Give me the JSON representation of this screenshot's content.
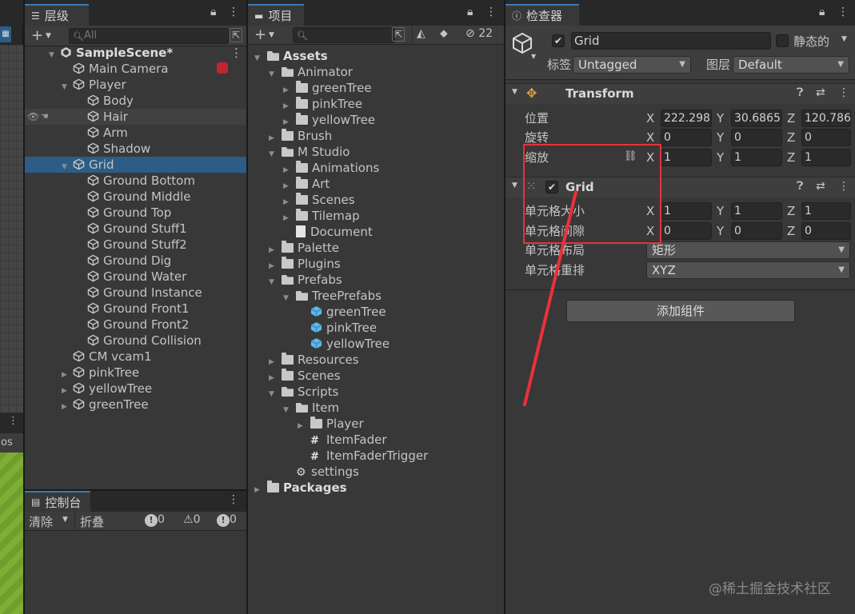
{
  "hierarchy": {
    "tab_label": "层级",
    "search_placeholder": "All",
    "rows": [
      {
        "label": "SampleScene*",
        "level": 0,
        "scene": true
      },
      {
        "label": "Main Camera",
        "level": 1
      },
      {
        "label": "Player",
        "level": 1,
        "fold": "open"
      },
      {
        "label": "Body",
        "level": 2
      },
      {
        "label": "Hair",
        "level": 2,
        "hover": true
      },
      {
        "label": "Arm",
        "level": 2
      },
      {
        "label": "Shadow",
        "level": 2
      },
      {
        "label": "Grid",
        "level": 1,
        "fold": "open",
        "selected": true
      },
      {
        "label": "Ground Bottom",
        "level": 2
      },
      {
        "label": "Ground Middle",
        "level": 2
      },
      {
        "label": "Ground Top",
        "level": 2
      },
      {
        "label": "Ground Stuff1",
        "level": 2
      },
      {
        "label": "Ground Stuff2",
        "level": 2
      },
      {
        "label": "Ground Dig",
        "level": 2
      },
      {
        "label": "Ground Water",
        "level": 2
      },
      {
        "label": "Ground Instance",
        "level": 2
      },
      {
        "label": "Ground Front1",
        "level": 2
      },
      {
        "label": "Ground Front2",
        "level": 2
      },
      {
        "label": "Ground Collision",
        "level": 2
      },
      {
        "label": "CM vcam1",
        "level": 1
      },
      {
        "label": "pinkTree",
        "level": 1,
        "fold": "closed"
      },
      {
        "label": "yellowTree",
        "level": 1,
        "fold": "closed"
      },
      {
        "label": "greenTree",
        "level": 1,
        "fold": "closed"
      }
    ]
  },
  "console": {
    "tab_label": "控制台",
    "clear_label": "清除",
    "collapse_label": "折叠",
    "info_count": "0",
    "warn_count": "0",
    "error_count": "0"
  },
  "left_strip": {
    "label": "os"
  },
  "project": {
    "tab_label": "项目",
    "hidden_count": "22",
    "rows": [
      {
        "label": "Assets",
        "level": 0,
        "fold": "open",
        "bold": true,
        "type": "folder-open"
      },
      {
        "label": "Animator",
        "level": 1,
        "fold": "open",
        "type": "folder-open"
      },
      {
        "label": "greenTree",
        "level": 2,
        "fold": "closed",
        "type": "folder"
      },
      {
        "label": "pinkTree",
        "level": 2,
        "fold": "closed",
        "type": "folder"
      },
      {
        "label": "yellowTree",
        "level": 2,
        "fold": "closed",
        "type": "folder"
      },
      {
        "label": "Brush",
        "level": 1,
        "fold": "closed",
        "type": "folder"
      },
      {
        "label": "M Studio",
        "level": 1,
        "fold": "open",
        "type": "folder-open"
      },
      {
        "label": "Animations",
        "level": 2,
        "fold": "closed",
        "type": "folder"
      },
      {
        "label": "Art",
        "level": 2,
        "fold": "closed",
        "type": "folder"
      },
      {
        "label": "Scenes",
        "level": 2,
        "fold": "closed",
        "type": "folder"
      },
      {
        "label": "Tilemap",
        "level": 2,
        "fold": "closed",
        "type": "folder"
      },
      {
        "label": "Document",
        "level": 2,
        "type": "doc"
      },
      {
        "label": "Palette",
        "level": 1,
        "fold": "closed",
        "type": "folder"
      },
      {
        "label": "Plugins",
        "level": 1,
        "fold": "closed",
        "type": "folder"
      },
      {
        "label": "Prefabs",
        "level": 1,
        "fold": "open",
        "type": "folder-open"
      },
      {
        "label": "TreePrefabs",
        "level": 2,
        "fold": "open",
        "type": "folder-open"
      },
      {
        "label": "greenTree",
        "level": 3,
        "type": "prefab"
      },
      {
        "label": "pinkTree",
        "level": 3,
        "type": "prefab"
      },
      {
        "label": "yellowTree",
        "level": 3,
        "type": "prefab"
      },
      {
        "label": "Resources",
        "level": 1,
        "fold": "closed",
        "type": "folder"
      },
      {
        "label": "Scenes",
        "level": 1,
        "fold": "closed",
        "type": "folder"
      },
      {
        "label": "Scripts",
        "level": 1,
        "fold": "open",
        "type": "folder-open"
      },
      {
        "label": "Item",
        "level": 2,
        "fold": "open",
        "type": "folder-open"
      },
      {
        "label": "Player",
        "level": 3,
        "fold": "closed",
        "type": "folder"
      },
      {
        "label": "ItemFader",
        "level": 3,
        "type": "script"
      },
      {
        "label": "ItemFaderTrigger",
        "level": 3,
        "type": "script"
      },
      {
        "label": "settings",
        "level": 2,
        "type": "settings"
      },
      {
        "label": "Packages",
        "level": 0,
        "fold": "closed",
        "bold": true,
        "type": "folder"
      }
    ]
  },
  "inspector": {
    "tab_label": "检查器",
    "object_name": "Grid",
    "static_label": "静态的",
    "tag_label": "标签",
    "tag_value": "Untagged",
    "layer_label": "图层",
    "layer_value": "Default",
    "transform": {
      "title": "Transform",
      "position_label": "位置",
      "rotation_label": "旋转",
      "scale_label": "缩放",
      "position": {
        "x": "222.298",
        "y": "30.6865",
        "z": "120.786"
      },
      "rotation": {
        "x": "0",
        "y": "0",
        "z": "0"
      },
      "scale": {
        "x": "1",
        "y": "1",
        "z": "1"
      }
    },
    "grid": {
      "title": "Grid",
      "cell_size_label": "单元格大小",
      "cell_gap_label": "单元格间隙",
      "cell_layout_label": "单元格布局",
      "cell_swizzle_label": "单元格重排",
      "cell_size": {
        "x": "1",
        "y": "1",
        "z": "1"
      },
      "cell_gap": {
        "x": "0",
        "y": "0",
        "z": "0"
      },
      "cell_layout_value": "矩形",
      "cell_swizzle_value": "XYZ"
    },
    "add_component_label": "添加组件",
    "axis_x": "X",
    "axis_y": "Y",
    "axis_z": "Z"
  },
  "watermark": "@稀土掘金技术社区",
  "colors": {
    "selection": "#2c5d87",
    "annotation_red": "#e8323a",
    "tab_accent": "#3a79bb"
  }
}
